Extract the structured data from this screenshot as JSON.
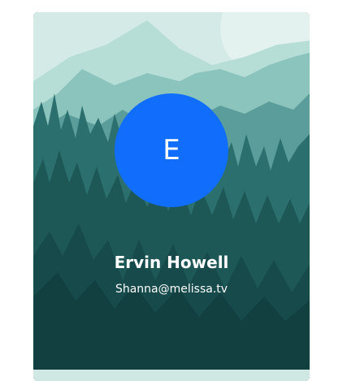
{
  "profile_card": {
    "initial": "E",
    "name": "Ervin Howell",
    "email": "Shanna@melissa.tv"
  },
  "colors": {
    "avatar_bg": "#116dfb",
    "sky": "#cfe8e3",
    "mountains_light": "#9fd0c9",
    "mountains_mid": "#6fb0aa",
    "forest_dark": "#0f3d3f"
  }
}
